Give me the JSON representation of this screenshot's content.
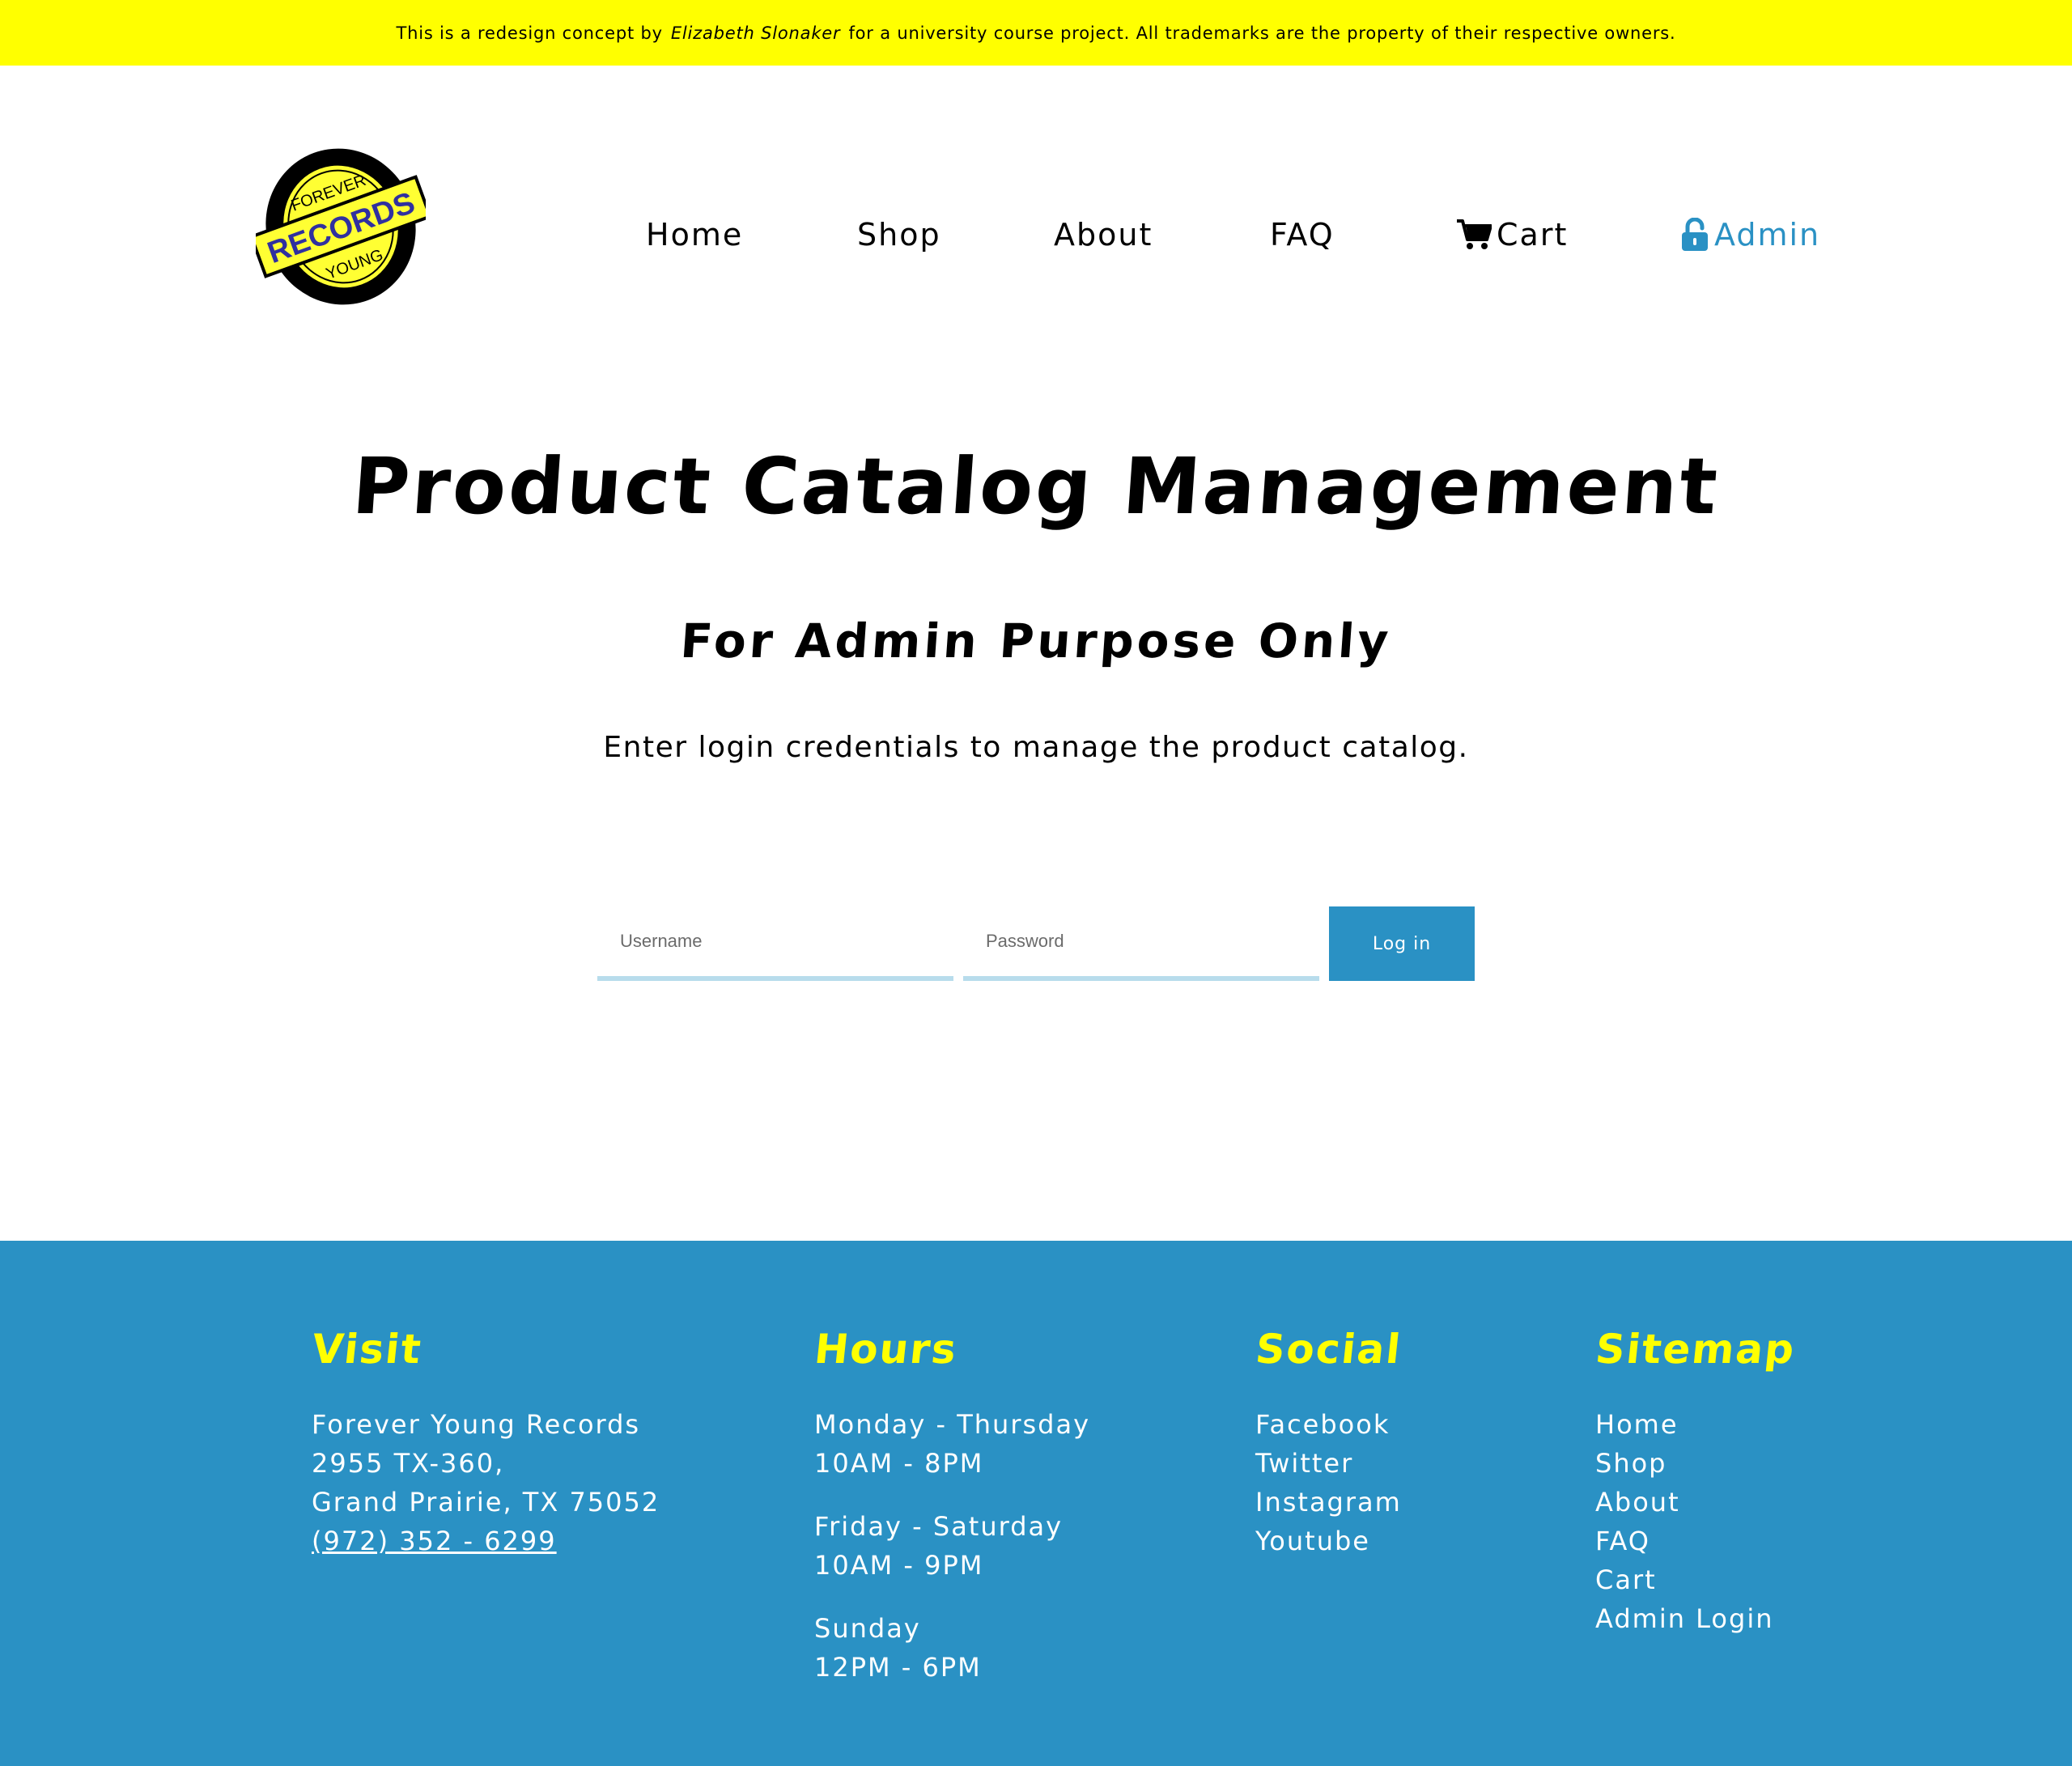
{
  "banner": {
    "prefix": "This is a redesign concept by",
    "author": "Elizabeth Slonaker",
    "suffix": "for a university course project. All trademarks are the property of their respective owners."
  },
  "logo": {
    "top_text": "FOREVER",
    "middle_text": "RECORDS",
    "bottom_text": "YOUNG"
  },
  "nav": {
    "home": "Home",
    "shop": "Shop",
    "about": "About",
    "faq": "FAQ",
    "cart": "Cart",
    "admin": "Admin"
  },
  "main": {
    "title": "Product Catalog Management",
    "subtitle": "For Admin Purpose Only",
    "intro": "Enter login credentials to manage the product catalog."
  },
  "login": {
    "username_placeholder": "Username",
    "password_placeholder": "Password",
    "button_label": "Log in"
  },
  "footer": {
    "visit": {
      "heading": "Visit",
      "name": "Forever Young Records",
      "street": "2955 TX-360,",
      "city": "Grand Prairie, TX 75052",
      "phone": "(972) 352 - 6299"
    },
    "hours": {
      "heading": "Hours",
      "weekday_days": "Monday - Thursday",
      "weekday_time": "10AM - 8PM",
      "weekend_days": "Friday - Saturday",
      "weekend_time": "10AM - 9PM",
      "sunday_days": "Sunday",
      "sunday_time": "12PM - 6PM"
    },
    "social": {
      "heading": "Social",
      "links": [
        "Facebook",
        "Twitter",
        "Instagram",
        "Youtube"
      ]
    },
    "sitemap": {
      "heading": "Sitemap",
      "links": [
        "Home",
        "Shop",
        "About",
        "FAQ",
        "Cart",
        "Admin Login"
      ]
    }
  },
  "colors": {
    "banner_bg": "#ffff00",
    "accent_blue": "#2a91c4",
    "footer_heading": "#ffff00",
    "input_underline": "#b8dcec"
  }
}
